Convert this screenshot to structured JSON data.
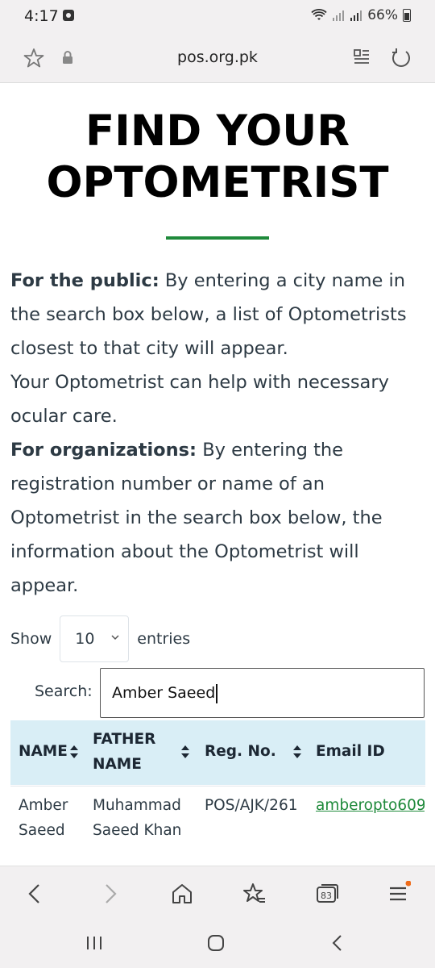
{
  "status": {
    "time": "4:17",
    "battery": "66%"
  },
  "browser": {
    "url": "pos.org.pk",
    "tab_count": "83"
  },
  "page": {
    "title_line1": "FIND YOUR",
    "title_line2": "OPTOMETRIST",
    "public_label": "For the public:",
    "public_text": " By entering a city name in the search box below, a list of Optometrists closest to that city will appear.",
    "public_text2": "Your Optometrist can help with necessary ocular care.",
    "org_label": "For organizations:",
    "org_text": " By entering the registration number or name of an Optometrist in the search box below, the information about the Optometrist will appear."
  },
  "table_controls": {
    "show_label": "Show",
    "entries_value": "10",
    "entries_label": "entries",
    "search_label": "Search:",
    "search_value": "Amber Saeed"
  },
  "table": {
    "headers": [
      "NAME",
      "FATHER NAME",
      "Reg. No.",
      "Email ID"
    ],
    "rows": [
      {
        "name": "Amber Saeed",
        "father_name": "Muhammad Saeed Khan",
        "reg_no": "POS/AJK/261",
        "email": "amberopto609"
      }
    ]
  },
  "colors": {
    "accent": "#1f8a3b",
    "table_header_bg": "#d9eef6",
    "chrome_bg": "#f2f0f1"
  }
}
